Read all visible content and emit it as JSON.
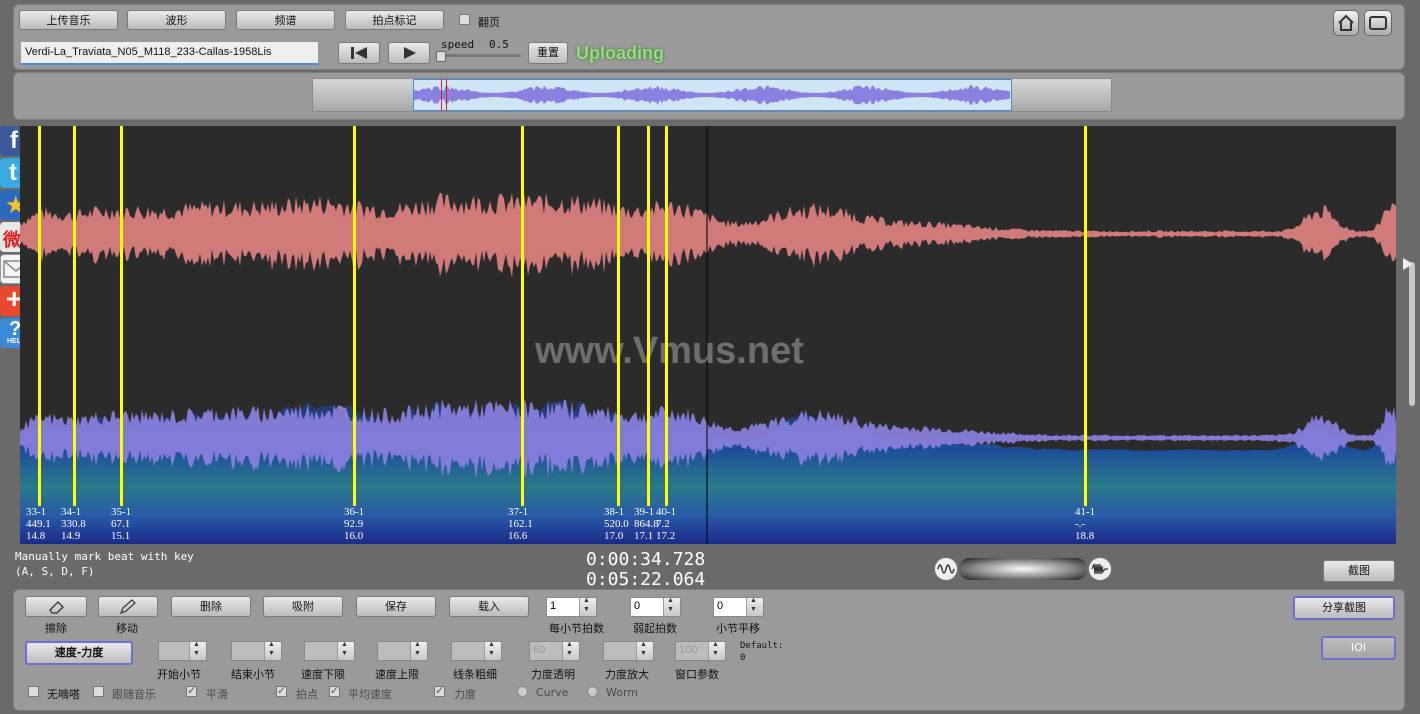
{
  "toolbar": {
    "upload": "上传音乐",
    "waveform": "波形",
    "spectrum": "频谱",
    "beat_mark": "拍点标记",
    "page_flip": "翻页"
  },
  "file": {
    "name": "Verdi-La_Traviata_N05_M118_233-Callas-1958Lis"
  },
  "playback": {
    "speed_label": "speed",
    "speed_value": "0.5",
    "reset": "重置",
    "status": "Uploading"
  },
  "watermark": "www.Vmus.net",
  "beats": [
    {
      "bar": "33-1",
      "tempo": "449.1",
      "dyn": "14.8"
    },
    {
      "bar": "34-1",
      "tempo": "330.8",
      "dyn": "14.9"
    },
    {
      "bar": "35-1",
      "tempo": "67.1",
      "dyn": "15.1"
    },
    {
      "bar": "36-1",
      "tempo": "92.9",
      "dyn": "16.0"
    },
    {
      "bar": "37-1",
      "tempo": "162.1",
      "dyn": "16.6"
    },
    {
      "bar": "38-1",
      "tempo": "520.0",
      "dyn": "17.0"
    },
    {
      "bar": "39-1",
      "tempo": "864.8",
      "dyn": "17.1"
    },
    {
      "bar": "40-1",
      "tempo": "7.2",
      "dyn": "17.2"
    },
    {
      "bar": "41-1",
      "tempo": "-.-",
      "dyn": "18.8"
    }
  ],
  "hint": {
    "line1": "Manually mark beat with key",
    "line2": "(A, S, D, F)"
  },
  "time": {
    "current": "0:00:34.728",
    "total": "0:05:22.064"
  },
  "screenshot_btn": "截图",
  "tools": {
    "erase": "擦除",
    "move": "移动",
    "delete": "删除",
    "snap": "吸附",
    "save": "保存",
    "load": "载入",
    "beats_per_bar_value": "1",
    "beats_per_bar": "每小节拍数",
    "pickup_value": "0",
    "pickup": "弱起拍数",
    "bar_shift_value": "0",
    "bar_shift": "小节平移",
    "share_screenshot": "分享截图",
    "ioi": "IOI"
  },
  "curve": {
    "mode": "速度-力度",
    "start_bar": "开始小节",
    "end_bar": "结束小节",
    "tempo_min": "速度下限",
    "tempo_max": "速度上限",
    "line_width": "线条粗细",
    "dyn_alpha_value": "50",
    "dyn_alpha": "力度透明",
    "dyn_zoom": "力度放大",
    "window_value": "100",
    "window": "窗口参数",
    "default_label": "Default:",
    "default_value": "0"
  },
  "options": {
    "no_click": "无嘀嗒",
    "follow_music": "跟随音乐",
    "smooth": "平滑",
    "beat": "拍点",
    "avg_tempo": "平均速度",
    "dynamics": "力度",
    "curve_radio": "Curve",
    "worm_radio": "Worm"
  },
  "colors": {
    "beat_line": "#ffff00",
    "upper_wave": "#d07a7a",
    "lower_wave": "#8a80e0",
    "status": "#8fe07a"
  }
}
